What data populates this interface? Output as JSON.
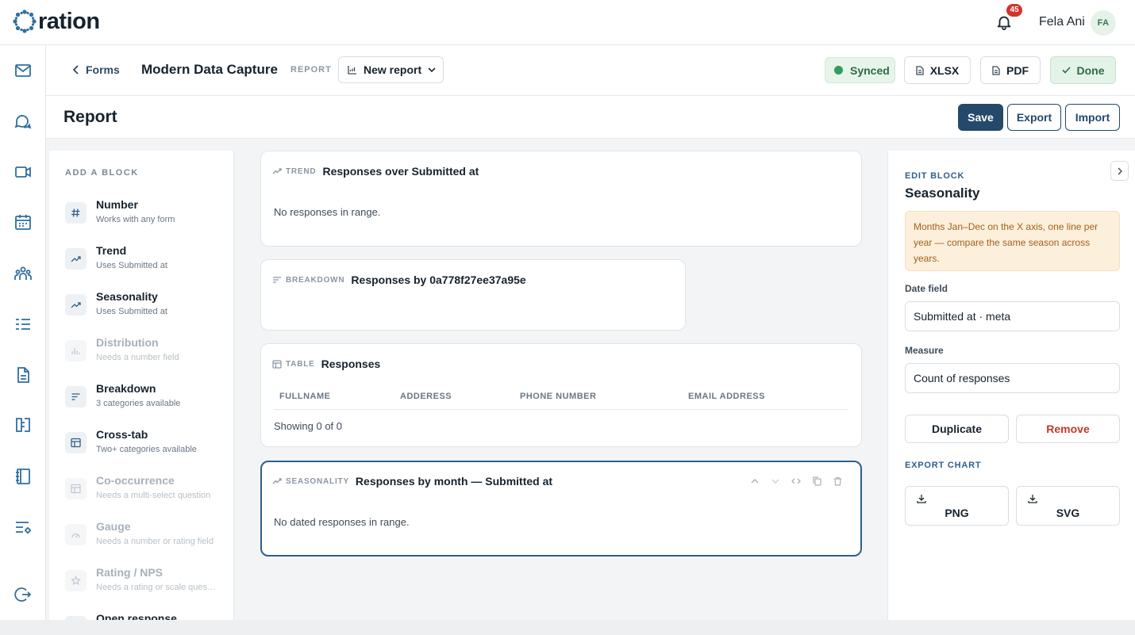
{
  "brand": {
    "logo_text": "ration"
  },
  "header": {
    "notification_count": "45",
    "user_name": "Fela Ani",
    "user_initials": "FA"
  },
  "rail": {
    "icons": [
      "mail-icon",
      "chat-icon",
      "video-icon",
      "calendar-icon",
      "team-icon",
      "list-icon",
      "document-icon",
      "dictionary-icon",
      "notebook-icon",
      "settings-list-icon",
      "logout-icon"
    ]
  },
  "subheader": {
    "back_label": "Forms",
    "form_title": "Modern Data Capture",
    "report_tag": "REPORT",
    "report_select": "New report",
    "synced_label": "Synced",
    "xlsx_label": "XLSX",
    "pdf_label": "PDF",
    "done_label": "Done"
  },
  "page": {
    "title": "Report",
    "save_label": "Save",
    "export_label": "Export",
    "import_label": "Import"
  },
  "palette": {
    "heading": "ADD A BLOCK",
    "items": [
      {
        "name": "Number",
        "desc": "Works with any form",
        "icon": "hash-icon",
        "enabled": true
      },
      {
        "name": "Trend",
        "desc": "Uses Submitted at",
        "icon": "trend-icon",
        "enabled": true
      },
      {
        "name": "Seasonality",
        "desc": "Uses Submitted at",
        "icon": "trend-icon",
        "enabled": true
      },
      {
        "name": "Distribution",
        "desc": "Needs a number field",
        "icon": "histogram-icon",
        "enabled": false
      },
      {
        "name": "Breakdown",
        "desc": "3 categories available",
        "icon": "bars-icon",
        "enabled": true
      },
      {
        "name": "Cross-tab",
        "desc": "Two+ categories available",
        "icon": "table-icon",
        "enabled": true
      },
      {
        "name": "Co-occurrence",
        "desc": "Needs a multi-select question",
        "icon": "table-icon",
        "enabled": false
      },
      {
        "name": "Gauge",
        "desc": "Needs a number or rating field",
        "icon": "gauge-icon",
        "enabled": false
      },
      {
        "name": "Rating / NPS",
        "desc": "Needs a rating or scale question",
        "icon": "star-icon",
        "enabled": false
      },
      {
        "name": "Open response",
        "desc": "",
        "icon": "text-icon",
        "enabled": true
      }
    ]
  },
  "blocks": {
    "trend": {
      "kind": "TREND",
      "title": "Responses over Submitted at",
      "empty": "No responses in range."
    },
    "breakdown": {
      "kind": "BREAKDOWN",
      "title": "Responses by 0a778f27ee37a95e"
    },
    "table": {
      "kind": "TABLE",
      "title": "Responses",
      "columns": [
        "FULLNAME",
        "ADDERESS",
        "PHONE NUMBER",
        "EMAIL ADDRESS"
      ],
      "footer": "Showing 0 of 0"
    },
    "seasonality": {
      "kind": "SEASONALITY",
      "title": "Responses by month — Submitted at",
      "empty": "No dated responses in range."
    }
  },
  "editor": {
    "section_label": "EDIT BLOCK",
    "title": "Seasonality",
    "hint": "Months Jan–Dec on the X axis, one line per year — compare the same season across years.",
    "date_field_label": "Date field",
    "date_field_value": "Submitted at · meta",
    "measure_label": "Measure",
    "measure_value": "Count of responses",
    "duplicate_label": "Duplicate",
    "remove_label": "Remove",
    "export_section_label": "EXPORT CHART",
    "png_label": "PNG",
    "svg_label": "SVG"
  },
  "colors": {
    "primary": "#24496b",
    "accent": "#2f5f8a",
    "success": "#2e9e5b",
    "danger": "#c0392b",
    "badge": "#d0342c",
    "warning_bg": "#fcefdc"
  }
}
